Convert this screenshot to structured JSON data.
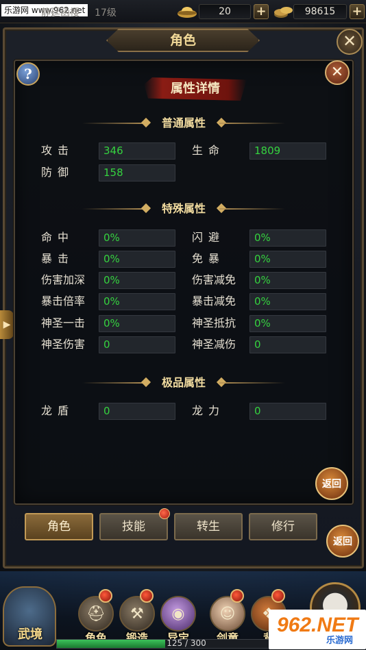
{
  "watermark_top_left": "乐游网 www.962.net",
  "status_bar": {
    "player_name": "静廷函樱",
    "player_level": "17级",
    "gold_ingot": "20",
    "coins": "98615",
    "plus": "+"
  },
  "window": {
    "title": "角色",
    "close": "✕"
  },
  "panel": {
    "title": "属性详情",
    "help": "?",
    "close": "✕",
    "sections": {
      "normal": "普通属性",
      "special": "特殊属性",
      "extreme": "极品属性"
    },
    "normal": [
      {
        "label": "攻击",
        "value": "346"
      },
      {
        "label": "生命",
        "value": "1809"
      },
      {
        "label": "防御",
        "value": "158"
      }
    ],
    "special": [
      {
        "label": "命中",
        "value": "0%"
      },
      {
        "label": "闪避",
        "value": "0%"
      },
      {
        "label": "暴击",
        "value": "0%"
      },
      {
        "label": "免暴",
        "value": "0%"
      },
      {
        "label": "伤害加深",
        "value": "0%"
      },
      {
        "label": "伤害减免",
        "value": "0%"
      },
      {
        "label": "暴击倍率",
        "value": "0%"
      },
      {
        "label": "暴击减免",
        "value": "0%"
      },
      {
        "label": "神圣一击",
        "value": "0%"
      },
      {
        "label": "神圣抵抗",
        "value": "0%"
      },
      {
        "label": "神圣伤害",
        "value": "0"
      },
      {
        "label": "神圣减伤",
        "value": "0"
      }
    ],
    "extreme": [
      {
        "label": "龙盾",
        "value": "0"
      },
      {
        "label": "龙力",
        "value": "0"
      }
    ]
  },
  "return_label": "返回",
  "tabs": [
    "角色",
    "技能",
    "转生",
    "修行"
  ],
  "bottom_nav": {
    "home": "武境",
    "items": [
      "角色",
      "锻造",
      "异宝",
      "剑童",
      "背"
    ]
  },
  "experience": {
    "text": "125 / 300",
    "fraction": 0.4167
  },
  "watermark_bottom": {
    "main": "962.NET",
    "sub": "乐游网"
  },
  "colors": {
    "value_green": "#35d33f",
    "section_gold": "#f2dca0",
    "panel_title_red": "#8a1c14"
  },
  "icons": {
    "gold_ingot": "gold-ingot-icon",
    "coins": "coin-stack-icon",
    "help": "question-icon",
    "close": "close-icon"
  }
}
